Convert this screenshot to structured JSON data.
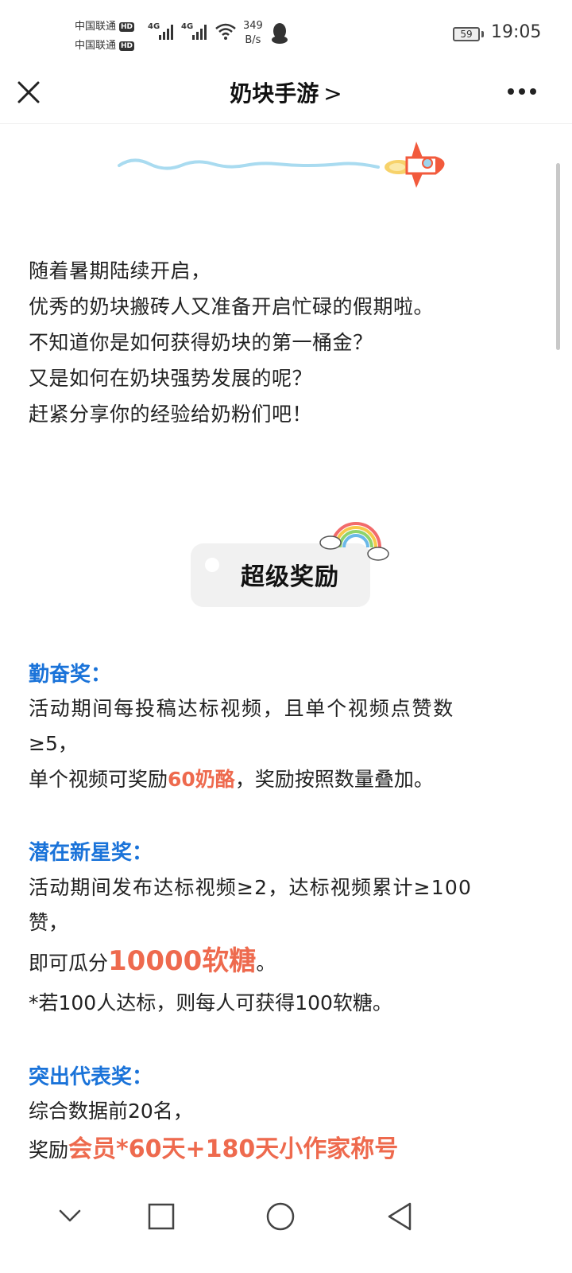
{
  "status": {
    "carrier1": "中国联通",
    "carrier2": "中国联通",
    "hd": "HD",
    "net_type": "4G",
    "speed_value": "349",
    "speed_unit": "B/s",
    "battery": "59",
    "time": "19:05"
  },
  "nav": {
    "title": "奶块手游",
    "chevron": ">"
  },
  "intro": {
    "lines": [
      "随着暑期陆续开启，",
      "优秀的奶块搬砖人又准备开启忙碌的假期啦。",
      "不知道你是如何获得奶块的第一桶金？",
      "又是如何在奶块强势发展的呢？",
      "赶紧分享你的经验给奶粉们吧！"
    ]
  },
  "badge": {
    "label": "超级奖励"
  },
  "awards": {
    "diligent": {
      "title": "勤奋奖：",
      "line1": "活动期间每投稿达标视频，且单个视频点赞数",
      "line1b": "≥5，",
      "line2_pre": "单个视频可奖励",
      "line2_highlight": "60奶酪",
      "line2_post": "，奖励按照数量叠加。"
    },
    "newstar": {
      "title": "潜在新星奖：",
      "line1": "活动期间发布达标视频≥2，达标视频累计≥100",
      "line1b": "赞，",
      "line2_pre": "即可瓜分",
      "line2_highlight": "10000软糖",
      "line2_post": "。",
      "note": "*若100人达标，则每人可获得100软糖。"
    },
    "outstanding": {
      "title": "突出代表奖：",
      "line1": "综合数据前20名，",
      "line2_pre": "奖励",
      "line2_highlight": "会员*60天+180天小作家称号"
    }
  },
  "colors": {
    "accent_blue": "#1a73d9",
    "highlight_orange": "#ee6a4e"
  }
}
